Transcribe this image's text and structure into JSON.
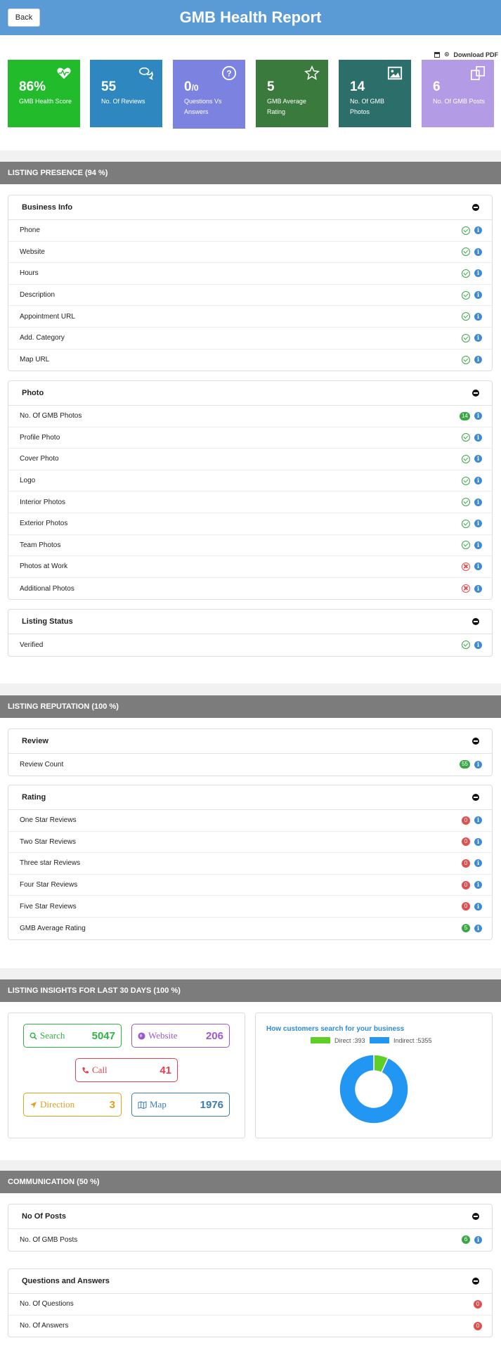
{
  "header": {
    "back_label": "Back",
    "title": "GMB Health Report",
    "download_label": "Download PDF"
  },
  "cards": [
    {
      "value": "86%",
      "label": "GMB Health Score",
      "color": "#21bb2b",
      "icon": "heartbeat-icon"
    },
    {
      "value": "55",
      "label": "No. Of Reviews",
      "color": "#2e88bf",
      "icon": "comments-icon"
    },
    {
      "value": "0",
      "value_suffix": "/0",
      "label": "Questions Vs Answers",
      "color": "#7b82e0",
      "icon": "question-circle-icon"
    },
    {
      "value": "5",
      "label": "GMB Average Rating",
      "color": "#3a7a3c",
      "icon": "star-icon"
    },
    {
      "value": "14",
      "label": "No. Of GMB Photos",
      "color": "#2c6f6a",
      "icon": "image-icon"
    },
    {
      "value": "6",
      "label": "No. Of GMB Posts",
      "color": "#b49be6",
      "icon": "copy-icon"
    }
  ],
  "presence": {
    "title": "LISTING PRESENCE (94 %)",
    "business_info": {
      "title": "Business Info",
      "rows": [
        {
          "label": "Phone",
          "status": "ok"
        },
        {
          "label": "Website",
          "status": "ok"
        },
        {
          "label": "Hours",
          "status": "ok"
        },
        {
          "label": "Description",
          "status": "ok"
        },
        {
          "label": "Appointment URL",
          "status": "ok"
        },
        {
          "label": "Add. Category",
          "status": "ok"
        },
        {
          "label": "Map URL",
          "status": "ok"
        }
      ]
    },
    "photo": {
      "title": "Photo",
      "rows": [
        {
          "label": "No. Of GMB Photos",
          "status": "count",
          "count": "14",
          "color": "green"
        },
        {
          "label": "Profile Photo",
          "status": "ok"
        },
        {
          "label": "Cover Photo",
          "status": "ok"
        },
        {
          "label": "Logo",
          "status": "ok"
        },
        {
          "label": "Interior Photos",
          "status": "ok"
        },
        {
          "label": "Exterior Photos",
          "status": "ok"
        },
        {
          "label": "Team Photos",
          "status": "ok"
        },
        {
          "label": "Photos at Work",
          "status": "fail"
        },
        {
          "label": "Additional Photos",
          "status": "fail"
        }
      ]
    },
    "status": {
      "title": "Listing Status",
      "rows": [
        {
          "label": "Verified",
          "status": "ok"
        }
      ]
    }
  },
  "reputation": {
    "title": "LISTING REPUTATION (100 %)",
    "review": {
      "title": "Review",
      "rows": [
        {
          "label": "Review Count",
          "status": "count",
          "count": "55",
          "color": "green"
        }
      ]
    },
    "rating": {
      "title": "Rating",
      "rows": [
        {
          "label": "One Star Reviews",
          "status": "count",
          "count": "0",
          "color": "red"
        },
        {
          "label": "Two Star Reviews",
          "status": "count",
          "count": "0",
          "color": "red"
        },
        {
          "label": "Three star Reviews",
          "status": "count",
          "count": "0",
          "color": "red"
        },
        {
          "label": "Four Star Reviews",
          "status": "count",
          "count": "0",
          "color": "red"
        },
        {
          "label": "Five Star Reviews",
          "status": "count",
          "count": "0",
          "color": "red"
        },
        {
          "label": "GMB Average Rating",
          "status": "count",
          "count": "5",
          "color": "green"
        }
      ]
    }
  },
  "insights": {
    "title": "LISTING INSIGHTS FOR LAST 30 DAYS (100 %)",
    "search": {
      "label": "Search",
      "value": "5047",
      "color": "#2fb344"
    },
    "website": {
      "label": "Website",
      "value": "206",
      "color": "#9b59d0"
    },
    "call": {
      "label": "Call",
      "value": "41",
      "color": "#e0424e"
    },
    "direction": {
      "label": "Direction",
      "value": "3",
      "color": "#e0a21b"
    },
    "map": {
      "label": "Map",
      "value": "1976",
      "color": "#3a7eb0"
    },
    "chart_title": "How customers search for your business"
  },
  "chart_data": {
    "type": "pie",
    "title": "How customers search for your business",
    "categories": [
      "Direct",
      "Indirect"
    ],
    "values": [
      393,
      5355
    ],
    "legend_labels": [
      "Direct :393",
      "Indirect :5355"
    ],
    "colors": [
      "#5fcf28",
      "#2196f3"
    ],
    "legend": "top"
  },
  "communication": {
    "title": "COMMUNICATION (50 %)",
    "posts": {
      "title": "No Of Posts",
      "rows": [
        {
          "label": "No. Of GMB Posts",
          "status": "count",
          "count": "6",
          "color": "green"
        }
      ]
    },
    "qa": {
      "title": "Questions and Answers",
      "rows": [
        {
          "label": "No. Of Questions",
          "status": "count_only",
          "count": "0",
          "color": "red"
        },
        {
          "label": "No. Of Answers",
          "status": "count_only",
          "count": "0",
          "color": "red"
        }
      ]
    }
  }
}
